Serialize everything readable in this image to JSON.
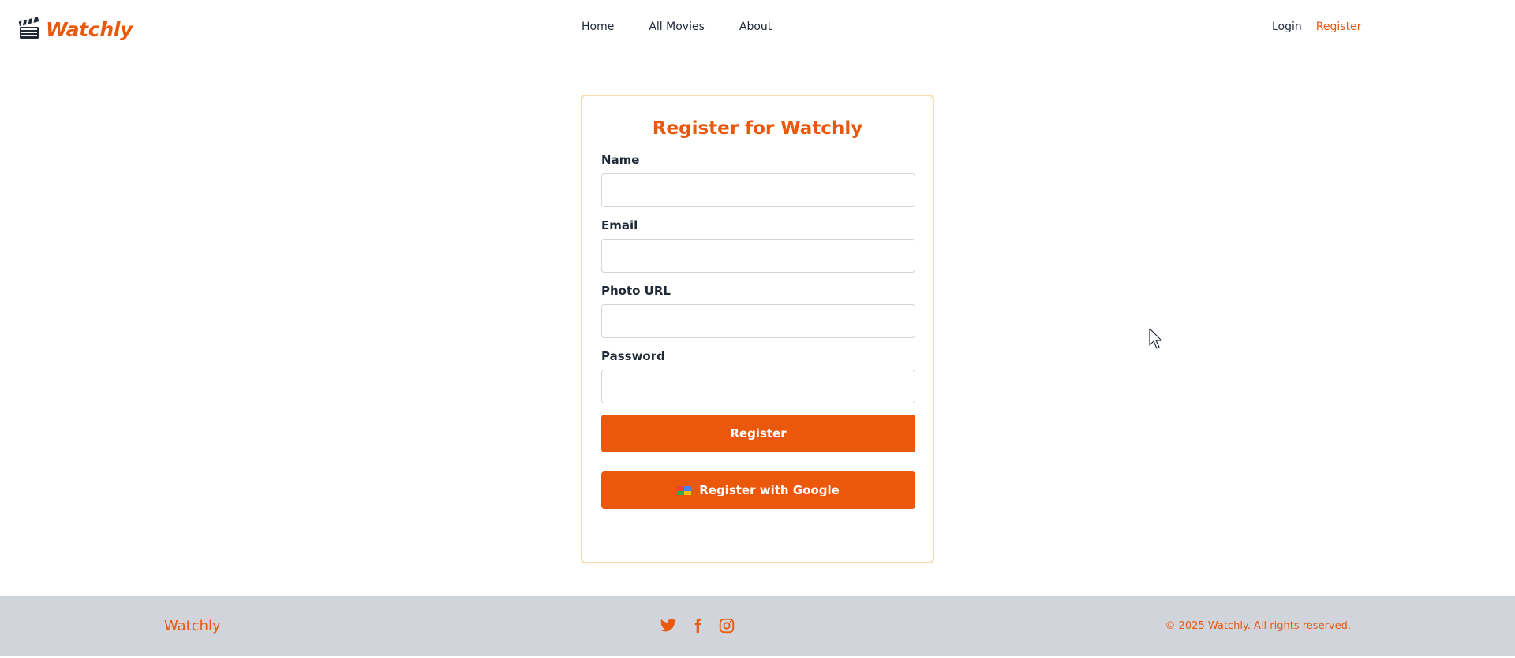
{
  "brand": {
    "name": "Watchly",
    "logo_icon": "clapperboard-icon",
    "accent_color": "#ea580c"
  },
  "nav": {
    "links": [
      "Home",
      "All Movies",
      "About"
    ],
    "login_label": "Login",
    "register_label": "Register"
  },
  "form": {
    "title": "Register for Watchly",
    "fields": [
      {
        "label": "Name",
        "value": "",
        "placeholder": ""
      },
      {
        "label": "Email",
        "value": "",
        "placeholder": ""
      },
      {
        "label": "Photo URL",
        "value": "",
        "placeholder": ""
      },
      {
        "label": "Password",
        "value": "",
        "placeholder": ""
      }
    ],
    "register_button": "Register",
    "google_button": "Register with Google",
    "google_icon": "google-icon"
  },
  "footer": {
    "brand": "Watchly",
    "social_icons": [
      "twitter-icon",
      "facebook-icon",
      "instagram-icon"
    ],
    "copyright": "© 2025 Watchly. All rights reserved."
  }
}
